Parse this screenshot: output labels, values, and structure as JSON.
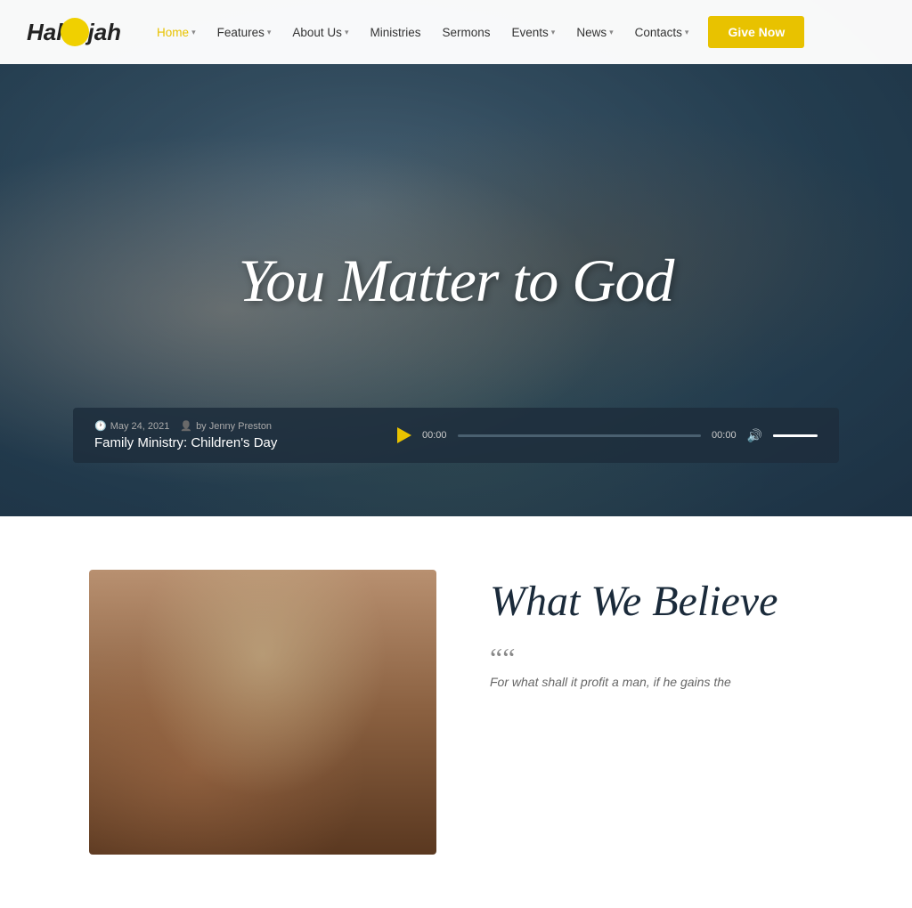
{
  "site": {
    "logo_text": "Hallelujah"
  },
  "navbar": {
    "links": [
      {
        "label": "Home",
        "active": true,
        "has_dropdown": true
      },
      {
        "label": "Features",
        "active": false,
        "has_dropdown": true
      },
      {
        "label": "About Us",
        "active": false,
        "has_dropdown": true
      },
      {
        "label": "Ministries",
        "active": false,
        "has_dropdown": false
      },
      {
        "label": "Sermons",
        "active": false,
        "has_dropdown": false
      },
      {
        "label": "Events",
        "active": false,
        "has_dropdown": true
      },
      {
        "label": "News",
        "active": false,
        "has_dropdown": true
      },
      {
        "label": "Contacts",
        "active": false,
        "has_dropdown": true
      }
    ],
    "cta_label": "Give Now"
  },
  "hero": {
    "title": "You Matter to God"
  },
  "audio": {
    "date": "May 24, 2021",
    "author": "by Jenny Preston",
    "title": "Family Ministry: Children's Day",
    "time_start": "00:00",
    "time_end": "00:00"
  },
  "below": {
    "section_title": "What We Believe",
    "quote_mark": "““",
    "quote_text": "For what shall it profit a man, if he gains the"
  }
}
